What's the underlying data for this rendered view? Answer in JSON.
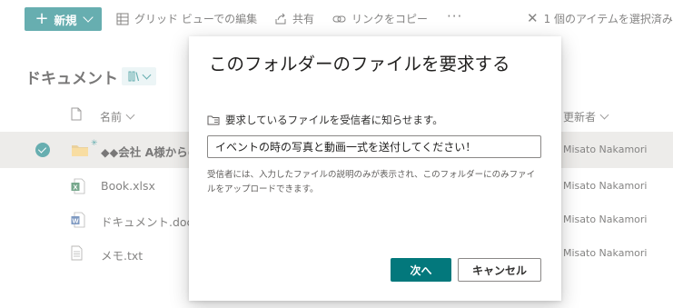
{
  "toolbar": {
    "new_label": "新規",
    "grid_edit_label": "グリッド ビューでの編集",
    "share_label": "共有",
    "copy_link_label": "リンクをコピー",
    "more_label": "···",
    "selection_label": "1 個のアイテムを選択済み"
  },
  "library": {
    "title": "ドキュメント",
    "columns": {
      "name": "名前",
      "modified_by": "更新者"
    },
    "rows": [
      {
        "name": "◆◆会社 A様からの",
        "modified_by": "Misato Nakamori",
        "icon": "folder-icon",
        "selected": true
      },
      {
        "name": "Book.xlsx",
        "modified_by": "Misato Nakamori",
        "icon": "excel-file-icon",
        "selected": false
      },
      {
        "name": "ドキュメント.docx",
        "modified_by": "Misato Nakamori",
        "icon": "word-file-icon",
        "selected": false
      },
      {
        "name": "メモ.txt",
        "modified_by": "Misato Nakamori",
        "icon": "text-file-icon",
        "selected": false
      }
    ]
  },
  "dialog": {
    "title": "このフォルダーのファイルを要求する",
    "prompt": "要求しているファイルを受信者に知らせます。",
    "input_value": "イベントの時の写真と動画一式を送付してください！",
    "note": "受信者には、入力したファイルの説明のみが表示され、このフォルダーにのみファイルをアップロードできます。",
    "next_label": "次へ",
    "cancel_label": "キャンセル"
  },
  "colors": {
    "accent": "#03787c",
    "selected_row": "#e1dfdd"
  }
}
